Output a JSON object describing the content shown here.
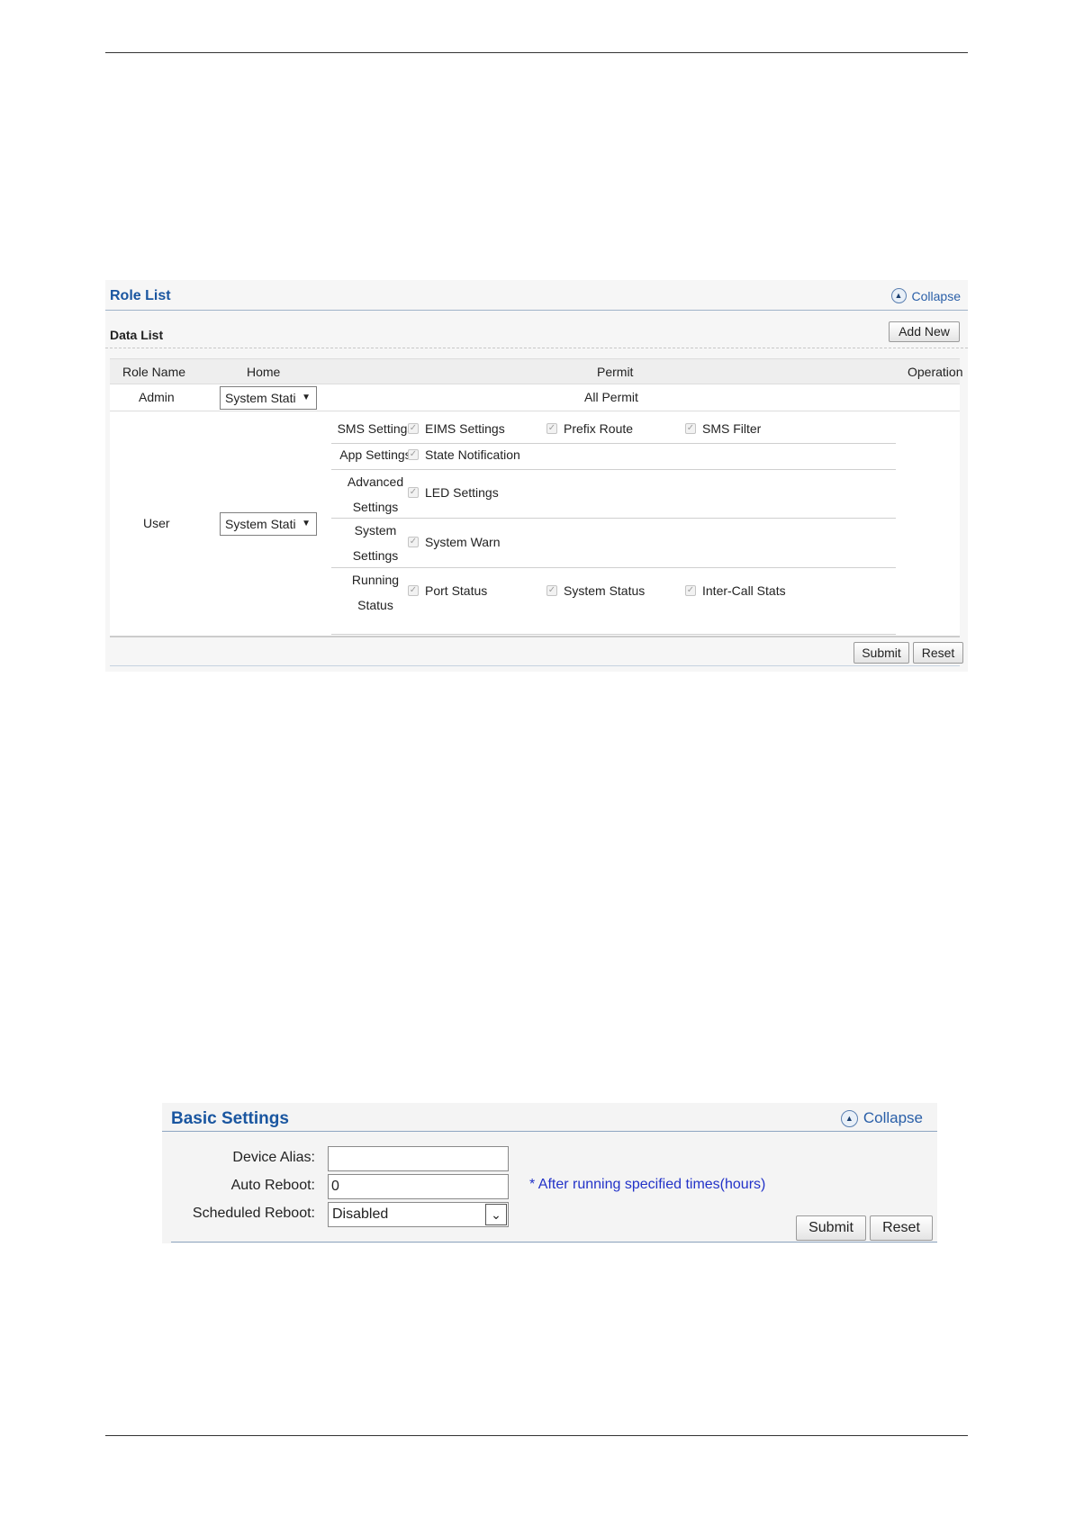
{
  "role_list": {
    "title": "Role List",
    "collapse_label": "Collapse",
    "sub_title": "Data List",
    "add_new_label": "Add New",
    "columns": {
      "role_name": "Role Name",
      "home": "Home",
      "permit": "Permit",
      "operation": "Operation"
    },
    "admin": {
      "name": "Admin",
      "home": "System Stati",
      "permit": "All Permit"
    },
    "user": {
      "name": "User",
      "home": "System Stati",
      "groups": [
        {
          "category": "SMS Settings",
          "items": [
            "EIMS Settings",
            "Prefix Route",
            "SMS Filter"
          ]
        },
        {
          "category": "App Settings",
          "items": [
            "State Notification"
          ]
        },
        {
          "category_line1": "Advanced",
          "category_line2": "Settings",
          "items": [
            "LED Settings"
          ]
        },
        {
          "category_line1": "System",
          "category_line2": "Settings",
          "items": [
            "System Warn"
          ]
        },
        {
          "category_line1": "Running",
          "category_line2": "Status",
          "items": [
            "Port Status",
            "System Status",
            "Inter-Call Stats"
          ]
        }
      ]
    },
    "submit_label": "Submit",
    "reset_label": "Reset"
  },
  "basic_settings": {
    "title": "Basic Settings",
    "collapse_label": "Collapse",
    "device_alias_label": "Device Alias:",
    "device_alias_value": "",
    "auto_reboot_label": "Auto Reboot:",
    "auto_reboot_value": "0",
    "auto_reboot_hint": "* After running specified times(hours)",
    "scheduled_reboot_label": "Scheduled Reboot:",
    "scheduled_reboot_value": "Disabled",
    "submit_label": "Submit",
    "reset_label": "Reset"
  },
  "colors": {
    "title_blue": "#1a56a0",
    "hint_blue": "#2232c8"
  }
}
